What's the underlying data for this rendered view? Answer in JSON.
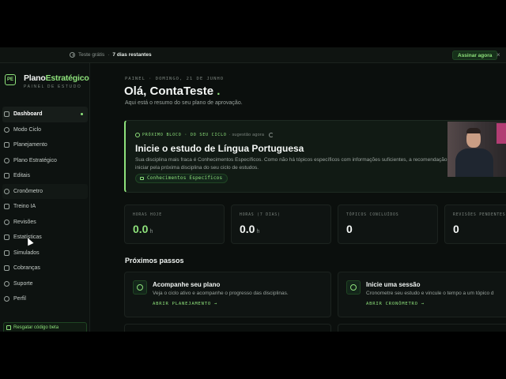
{
  "banner": {
    "trial_label": "Teste grátis",
    "trial_separator": "·",
    "trial_remaining": "7 dias restantes",
    "subscribe": "Assinar agora",
    "close": "×"
  },
  "sidebar": {
    "logo_mark": "PE",
    "brand_main": "Plano",
    "brand_accent": "Estratégico",
    "brand_sub": "PAINEL DE ESTUDO",
    "items": [
      {
        "label": "Dashboard",
        "icon": "grid-icon"
      },
      {
        "label": "Modo Ciclo",
        "icon": "cycle-icon"
      },
      {
        "label": "Planejamento",
        "icon": "calendar-icon"
      },
      {
        "label": "Plano Estratégico",
        "icon": "target-icon"
      },
      {
        "label": "Editais",
        "icon": "book-icon"
      },
      {
        "label": "Cronômetro",
        "icon": "timer-icon"
      },
      {
        "label": "Treino IA",
        "icon": "spark-icon"
      },
      {
        "label": "Revisões",
        "icon": "refresh-icon"
      },
      {
        "label": "Estatísticas",
        "icon": "chart-icon"
      },
      {
        "label": "Simulados",
        "icon": "clipboard-icon"
      },
      {
        "label": "Cobranças",
        "icon": "card-icon"
      },
      {
        "label": "Suporte",
        "icon": "help-icon"
      },
      {
        "label": "Perfil",
        "icon": "user-icon"
      }
    ],
    "redeem": "Resgatar código beta"
  },
  "main": {
    "breadcrumb": "PAINEL · DOMINGO, 21 DE JUNHO",
    "greeting": "Olá, ContaTeste",
    "greeting_period": ".",
    "subtitle": "Aqui está o resumo do seu plano de aprovação.",
    "hero": {
      "tag": "PRÓXIMO BLOCO · DO SEU CICLO",
      "tag_meta": "· sugestão agora",
      "title": "Inicie o estudo de Língua Portuguesa",
      "description": "Sua disciplina mais fraca é Conhecimentos Específicos. Como não há tópicos específicos com informações suficientes, a recomendação é iniciar pela próxima disciplina do seu ciclo de estudos.",
      "chip": "Conhecimentos Específicos"
    },
    "stats": [
      {
        "label": "HORAS HOJE",
        "value": "0.0",
        "unit": "h"
      },
      {
        "label": "HORAS (7 DIAS)",
        "value": "0.0",
        "unit": "h"
      },
      {
        "label": "TÓPICOS CONCLUÍDOS",
        "value": "0",
        "unit": ""
      },
      {
        "label": "REVISÕES PENDENTES",
        "value": "0",
        "unit": ""
      }
    ],
    "next_steps_title": "Próximos passos",
    "cards": [
      {
        "title": "Acompanhe seu plano",
        "description": "Veja o ciclo ativo e acompanhe o progresso das disciplinas.",
        "link": "ABRIR PLANEJAMENTO →"
      },
      {
        "title": "Inicie uma sessão",
        "description": "Cronometre seu estudo e vincule o tempo a um tópico d",
        "link": "ABRIR CRONÔMETRO →"
      }
    ]
  },
  "colors": {
    "accent": "#8ee27b",
    "background": "#0b0f0d"
  }
}
